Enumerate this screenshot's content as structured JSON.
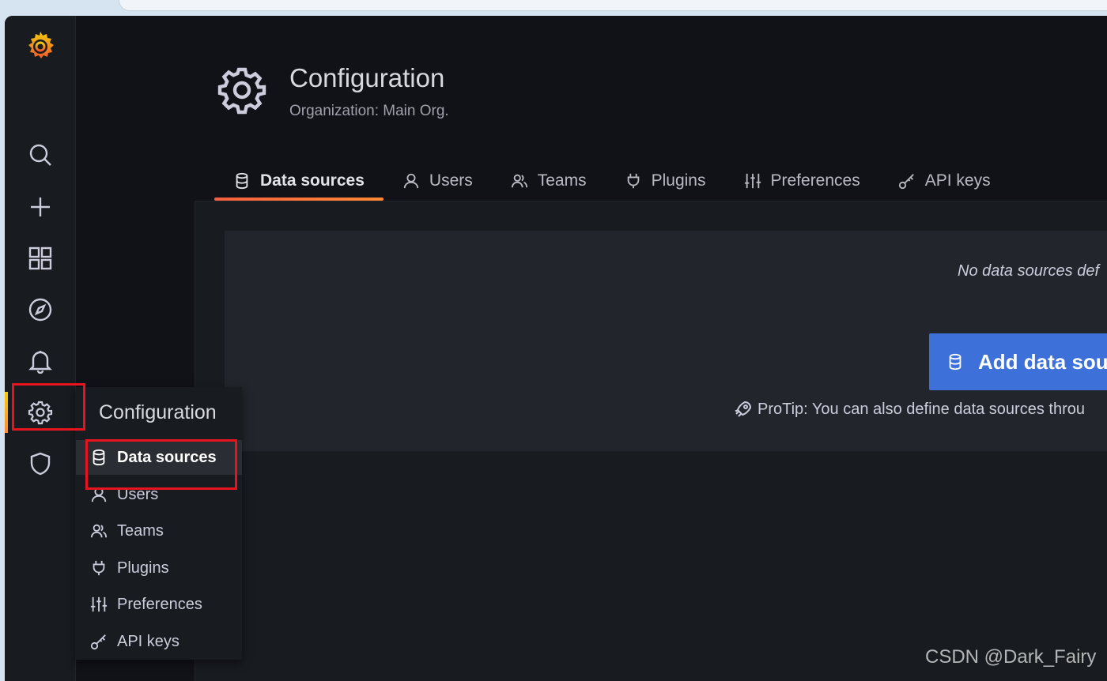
{
  "page": {
    "title": "Configuration",
    "subtitle": "Organization: Main Org."
  },
  "tabs": [
    {
      "label": "Data sources",
      "icon": "database-icon",
      "active": true
    },
    {
      "label": "Users",
      "icon": "user-icon"
    },
    {
      "label": "Teams",
      "icon": "users-icon"
    },
    {
      "label": "Plugins",
      "icon": "plug-icon"
    },
    {
      "label": "Preferences",
      "icon": "sliders-icon"
    },
    {
      "label": "API keys",
      "icon": "key-icon"
    }
  ],
  "empty_state": {
    "message": "No data sources def",
    "button_label": "Add data sou",
    "protip": "ProTip: You can also define data sources throu"
  },
  "sidemenu": {
    "items": [
      {
        "icon": "search-icon"
      },
      {
        "icon": "plus-icon"
      },
      {
        "icon": "dashboards-icon"
      },
      {
        "icon": "compass-icon"
      },
      {
        "icon": "bell-icon"
      },
      {
        "icon": "gear-icon",
        "active": true
      },
      {
        "icon": "shield-icon"
      }
    ]
  },
  "dropdown": {
    "title": "Configuration",
    "items": [
      {
        "label": "Data sources",
        "icon": "database-icon",
        "active": true
      },
      {
        "label": "Users",
        "icon": "user-icon"
      },
      {
        "label": "Teams",
        "icon": "users-icon"
      },
      {
        "label": "Plugins",
        "icon": "plug-icon"
      },
      {
        "label": "Preferences",
        "icon": "sliders-icon"
      },
      {
        "label": "API keys",
        "icon": "key-icon"
      }
    ]
  },
  "watermark": "CSDN @Dark_Fairy",
  "colors": {
    "accent_blue": "#3d71d9",
    "tab_underline": "#ff8833",
    "highlight_red": "#e5141f",
    "background": "#111217"
  }
}
